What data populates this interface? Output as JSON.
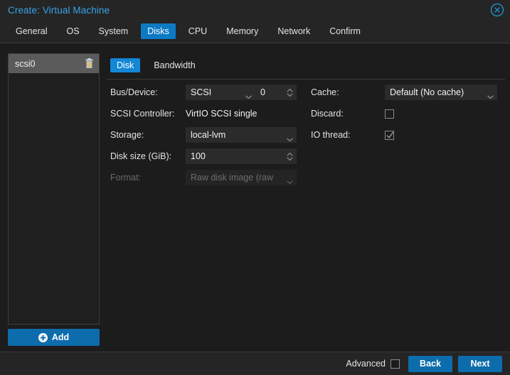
{
  "dialog": {
    "title": "Create: Virtual Machine",
    "close_icon": "close-circle-icon"
  },
  "tabs": [
    {
      "label": "General",
      "active": false
    },
    {
      "label": "OS",
      "active": false
    },
    {
      "label": "System",
      "active": false
    },
    {
      "label": "Disks",
      "active": true
    },
    {
      "label": "CPU",
      "active": false
    },
    {
      "label": "Memory",
      "active": false
    },
    {
      "label": "Network",
      "active": false
    },
    {
      "label": "Confirm",
      "active": false
    }
  ],
  "sidebar": {
    "items": [
      {
        "label": "scsi0",
        "selected": true,
        "delete_icon": "trash-icon"
      }
    ],
    "add_button": {
      "label": "Add",
      "icon": "plus-circle-icon"
    }
  },
  "subtabs": [
    {
      "label": "Disk",
      "active": true
    },
    {
      "label": "Bandwidth",
      "active": false
    }
  ],
  "form": {
    "bus_device": {
      "label": "Bus/Device:",
      "bus_value": "SCSI",
      "device_value": "0"
    },
    "scsi_controller": {
      "label": "SCSI Controller:",
      "value": "VirtIO SCSI single"
    },
    "storage": {
      "label": "Storage:",
      "value": "local-lvm"
    },
    "disk_size": {
      "label": "Disk size (GiB):",
      "value": "100"
    },
    "format": {
      "label": "Format:",
      "value": "Raw disk image (raw",
      "disabled": true
    },
    "cache": {
      "label": "Cache:",
      "value": "Default (No cache)"
    },
    "discard": {
      "label": "Discard:",
      "checked": false
    },
    "io_thread": {
      "label": "IO thread:",
      "checked": true
    }
  },
  "footer": {
    "advanced_label": "Advanced",
    "advanced_checked": false,
    "back_label": "Back",
    "next_label": "Next"
  },
  "colors": {
    "accent_blue": "#0d7ac4",
    "title_blue": "#35a4e8",
    "button_blue": "#0d6cab",
    "background": "#1c1c1c",
    "panel": "#252525"
  }
}
